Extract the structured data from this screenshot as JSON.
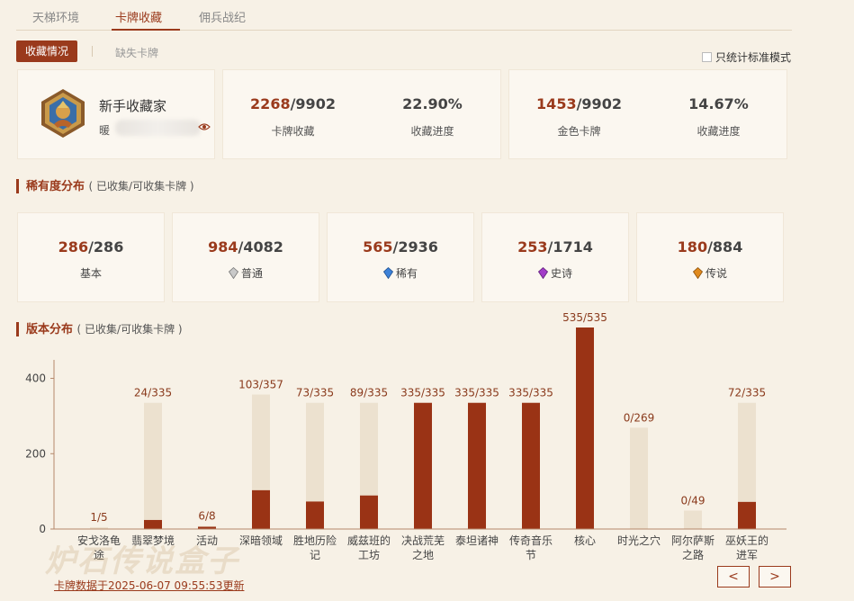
{
  "topnav": {
    "tabs": [
      {
        "label": "天梯环境"
      },
      {
        "label": "卡牌收藏"
      },
      {
        "label": "佣兵战纪"
      }
    ]
  },
  "subtabs": {
    "active": "收藏情况",
    "inactive": "缺失卡牌"
  },
  "std_mode": {
    "label": "只统计标准模式"
  },
  "profile": {
    "title": "新手收藏家",
    "user_prefix": "暖"
  },
  "collection": {
    "owned": "2268",
    "total": "/9902",
    "owned_label": "卡牌收藏",
    "progress": "22.90%",
    "progress_label": "收藏进度"
  },
  "golden": {
    "owned": "1453",
    "total": "/9902",
    "owned_label": "金色卡牌",
    "progress": "14.67%",
    "progress_label": "收藏进度"
  },
  "rarity_section": {
    "title": "稀有度分布",
    "subtitle": "( 已收集/可收集卡牌 )"
  },
  "rarity": [
    {
      "owned": "286",
      "total": "/286",
      "label": "基本",
      "gem": "none"
    },
    {
      "owned": "984",
      "total": "/4082",
      "label": "普通",
      "gem": "#b9b9b9"
    },
    {
      "owned": "565",
      "total": "/2936",
      "label": "稀有",
      "gem": "#3d82d8"
    },
    {
      "owned": "253",
      "total": "/1714",
      "label": "史诗",
      "gem": "#a23cc8"
    },
    {
      "owned": "180",
      "total": "/884",
      "label": "传说",
      "gem": "#e08a1e"
    }
  ],
  "version_section": {
    "title": "版本分布",
    "subtitle": "( 已收集/可收集卡牌 )"
  },
  "chart_data": {
    "type": "bar",
    "categories": [
      "安戈洛龟途",
      "翡翠梦境",
      "活动",
      "深暗领域",
      "胜地历险记",
      "威兹班的工坊",
      "决战荒芜之地",
      "泰坦诸神",
      "传奇音乐节",
      "核心",
      "时光之穴",
      "阿尔萨斯之路",
      "巫妖王的进军"
    ],
    "category_lines": [
      [
        "安戈洛龟",
        "途"
      ],
      [
        "翡翠梦境"
      ],
      [
        "活动"
      ],
      [
        "深暗领域"
      ],
      [
        "胜地历险",
        "记"
      ],
      [
        "威兹班的",
        "工坊"
      ],
      [
        "决战荒芜",
        "之地"
      ],
      [
        "泰坦诸神"
      ],
      [
        "传奇音乐",
        "节"
      ],
      [
        "核心"
      ],
      [
        "时光之穴"
      ],
      [
        "阿尔萨斯",
        "之路"
      ],
      [
        "巫妖王的",
        "进军"
      ]
    ],
    "series": [
      {
        "values": [
          1,
          24,
          6,
          103,
          73,
          89,
          335,
          335,
          335,
          535,
          0,
          0,
          72
        ]
      },
      {
        "values": [
          5,
          335,
          8,
          357,
          335,
          335,
          335,
          335,
          335,
          535,
          269,
          49,
          335
        ]
      }
    ],
    "labels": [
      "1/5",
      "24/335",
      "6/8",
      "103/357",
      "73/335",
      "89/335",
      "335/335",
      "335/335",
      "335/335",
      "535/535",
      "0/269",
      "0/49",
      "72/335"
    ],
    "yticks": [
      0,
      200,
      400
    ],
    "ylim": [
      0,
      535
    ],
    "colors": {
      "owned": "#9a3315",
      "total": "#ece1cf"
    }
  },
  "footer": {
    "text": "卡牌数据于2025-06-07 09:55:53更新",
    "watermark": "炉石传说盒子"
  },
  "pager": {
    "prev": "<",
    "next": ">"
  }
}
